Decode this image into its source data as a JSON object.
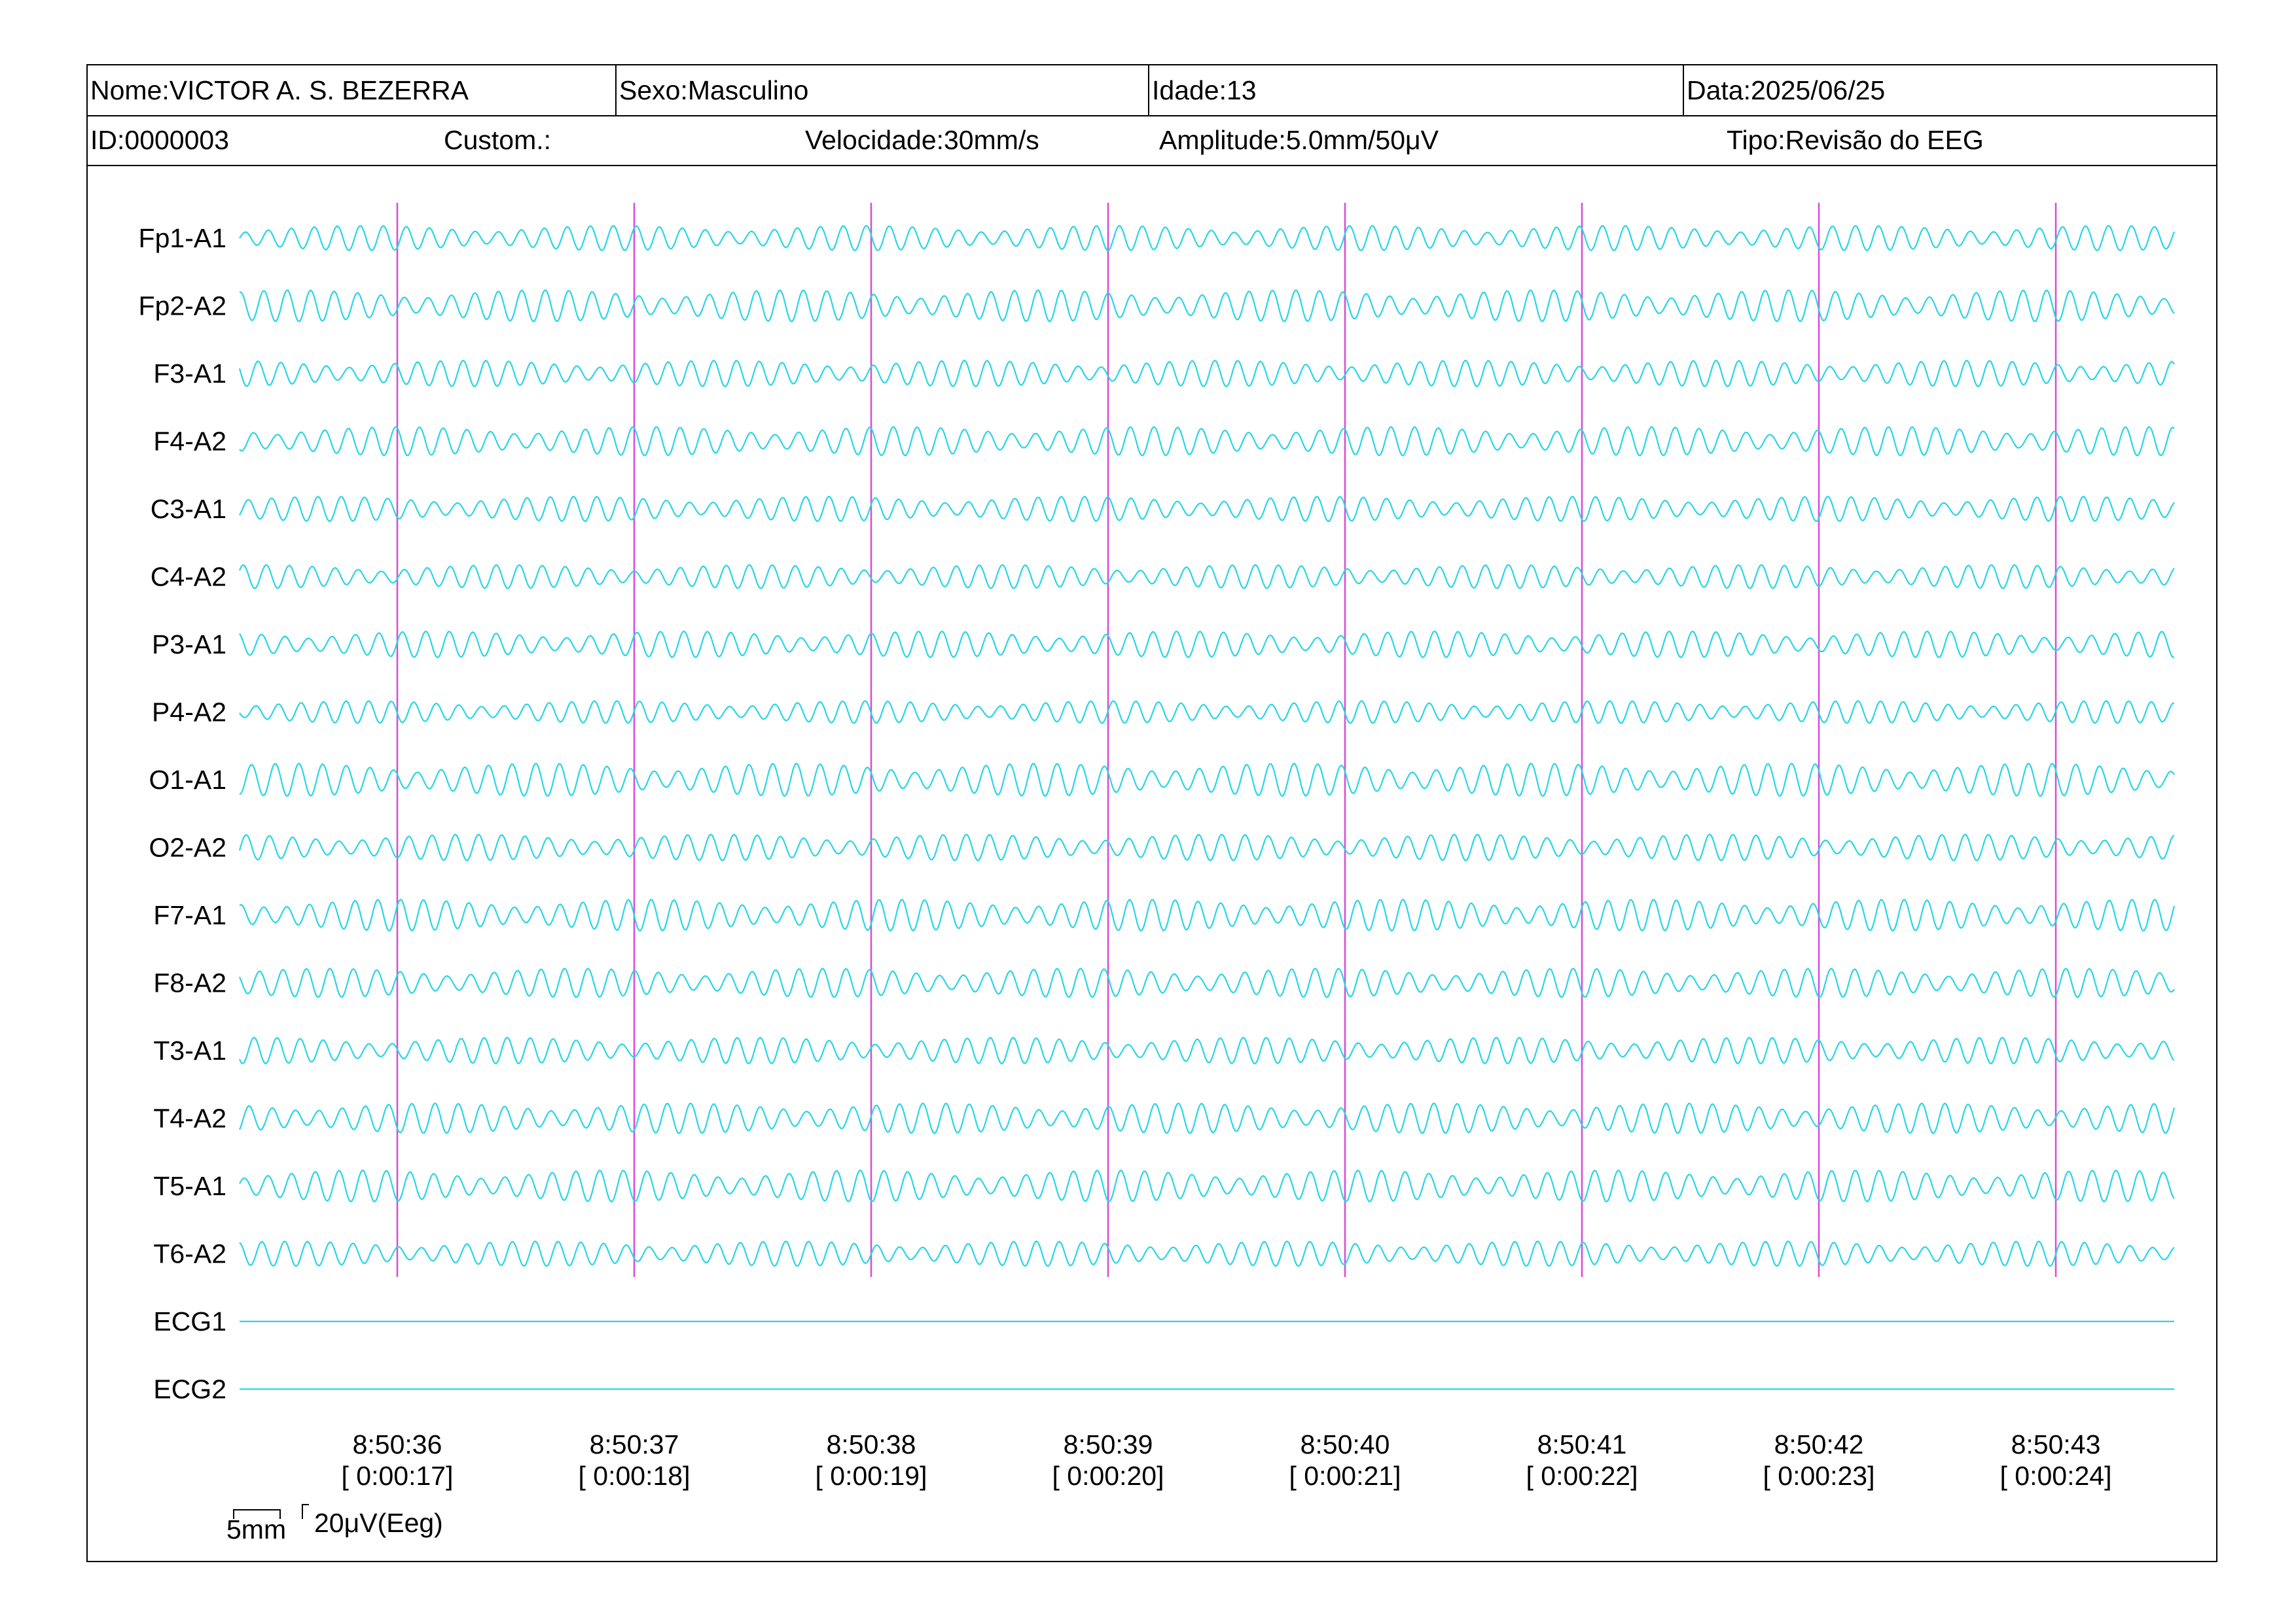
{
  "header": {
    "nome": "Nome:VICTOR A. S. BEZERRA",
    "sexo": "Sexo:Masculino",
    "idade": "Idade:13",
    "data": "Data:2025/06/25",
    "id": "ID:0000003",
    "custom": "Custom.:",
    "velocidade": "Velocidade:30mm/s",
    "amplitude": "Amplitude:5.0mm/50μV",
    "tipo": "Tipo:Revisão do EEG"
  },
  "colors": {
    "trace": "#27d6e6",
    "marker": "#d84ad8",
    "frame": "#000000"
  },
  "channels": [
    "Fp1-A1",
    "Fp2-A2",
    "F3-A1",
    "F4-A2",
    "C3-A1",
    "C4-A2",
    "P3-A1",
    "P4-A2",
    "O1-A1",
    "O2-A2",
    "F7-A1",
    "F8-A2",
    "T3-A1",
    "T4-A2",
    "T5-A1",
    "T6-A2",
    "ECG1",
    "ECG2"
  ],
  "time_marks": [
    {
      "clock": "8:50:36",
      "elapsed": "[ 0:00:17]"
    },
    {
      "clock": "8:50:37",
      "elapsed": "[ 0:00:18]"
    },
    {
      "clock": "8:50:38",
      "elapsed": "[ 0:00:19]"
    },
    {
      "clock": "8:50:39",
      "elapsed": "[ 0:00:20]"
    },
    {
      "clock": "8:50:40",
      "elapsed": "[ 0:00:21]"
    },
    {
      "clock": "8:50:41",
      "elapsed": "[ 0:00:22]"
    },
    {
      "clock": "8:50:42",
      "elapsed": "[ 0:00:23]"
    },
    {
      "clock": "8:50:43",
      "elapsed": "[ 0:00:24]"
    }
  ],
  "scale_legend": {
    "time": "5mm",
    "amplitude": "20μV(Eeg)"
  }
}
